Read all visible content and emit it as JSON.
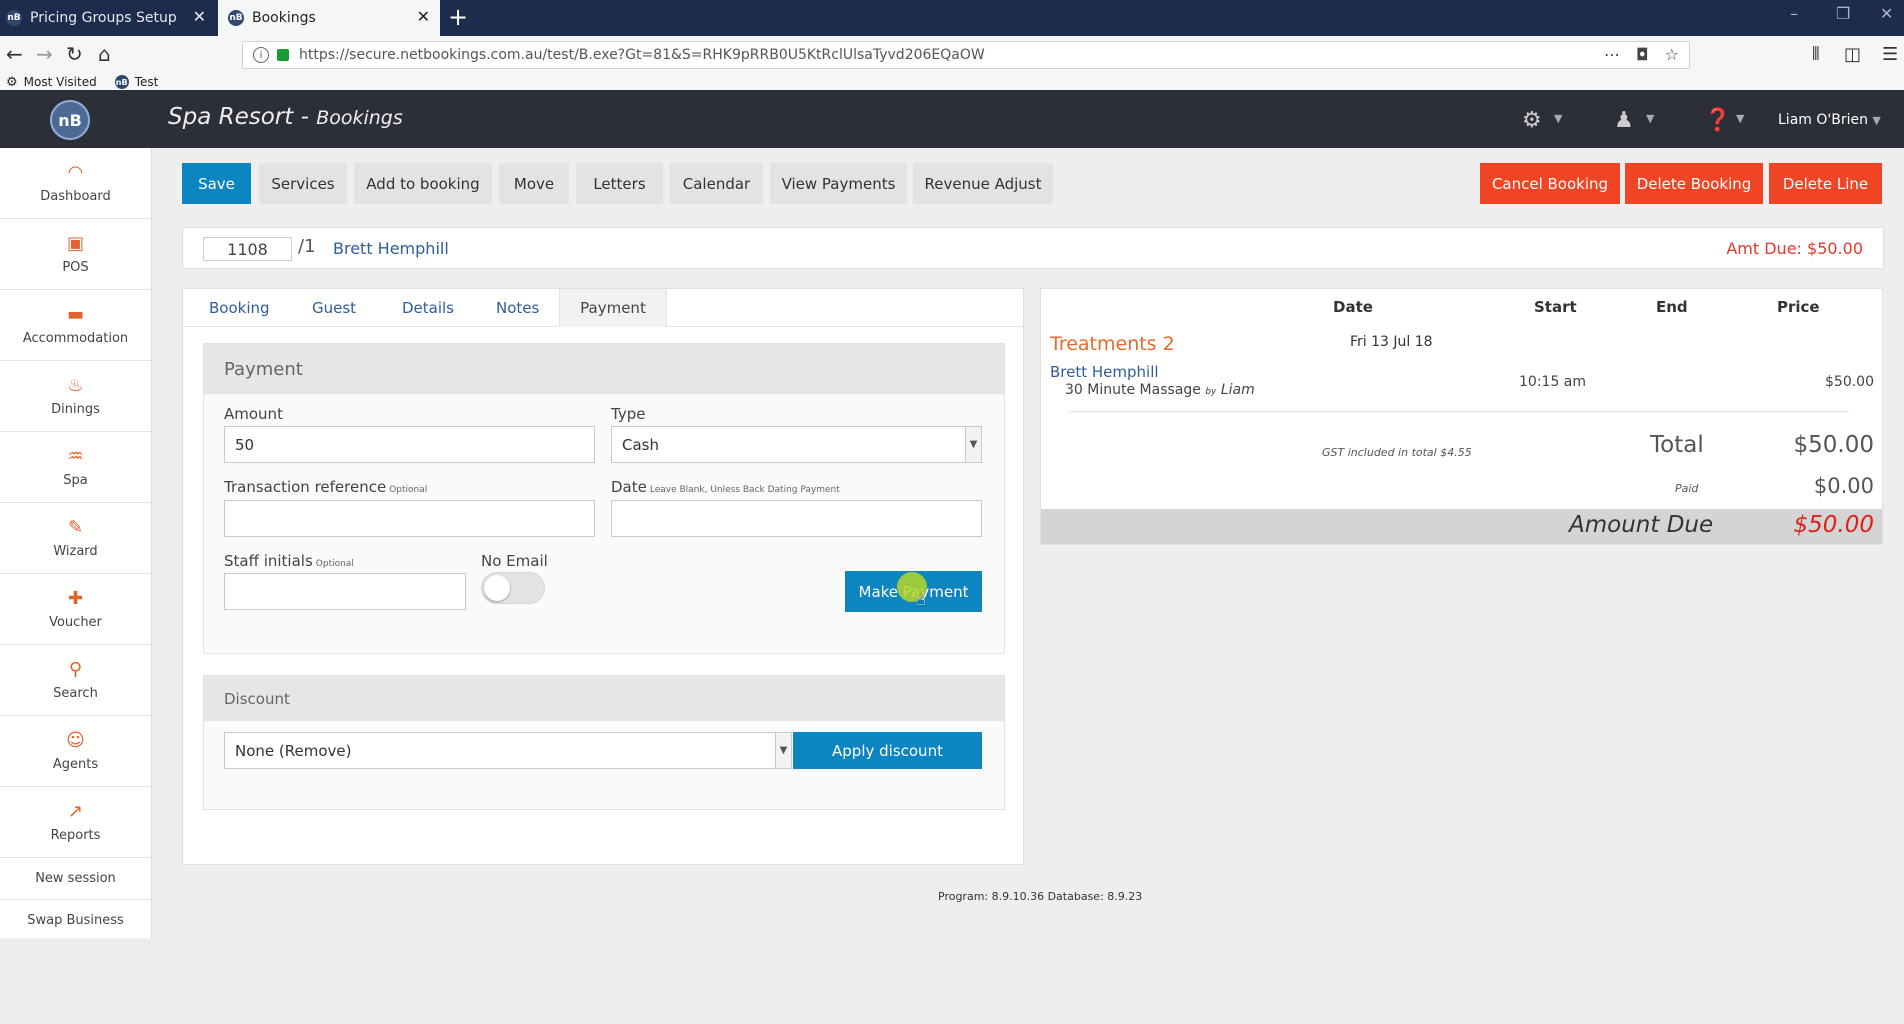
{
  "browser": {
    "tabs": [
      {
        "title": "Pricing Groups Setup",
        "favicon": "nB"
      },
      {
        "title": "Bookings",
        "favicon": "nB"
      }
    ],
    "close_glyph": "✕",
    "new_tab_glyph": "+",
    "url": "https://secure.netbookings.com.au/test/B.exe?Gt=81&S=RHK9pRRB0U5KtRclUlsaTyvd206EQaOW",
    "bookmarks": [
      {
        "label": "Most Visited",
        "icon": "gear-icon"
      },
      {
        "label": "Test",
        "icon": "nb-logo-icon"
      }
    ]
  },
  "app": {
    "logo_text": "nB",
    "title": "Spa Resort - ",
    "subtitle": "Bookings",
    "user": "Liam O'Brien"
  },
  "sidebar": {
    "items": [
      {
        "label": "Dashboard",
        "icon": "dashboard-icon",
        "glyph": "◠"
      },
      {
        "label": "POS",
        "icon": "pos-icon",
        "glyph": "▣"
      },
      {
        "label": "Accommodation",
        "icon": "bed-icon",
        "glyph": "▬"
      },
      {
        "label": "Dinings",
        "icon": "dining-icon",
        "glyph": "♨"
      },
      {
        "label": "Spa",
        "icon": "spa-icon",
        "glyph": "♒"
      },
      {
        "label": "Wizard",
        "icon": "wand-icon",
        "glyph": "✎"
      },
      {
        "label": "Voucher",
        "icon": "gift-icon",
        "glyph": "✚"
      },
      {
        "label": "Search",
        "icon": "search-icon",
        "glyph": "⚲"
      },
      {
        "label": "Agents",
        "icon": "agent-icon",
        "glyph": "☺"
      },
      {
        "label": "Reports",
        "icon": "reports-icon",
        "glyph": "↗"
      }
    ],
    "new_session": "New session",
    "swap_business": "Swap Business"
  },
  "toolbar": {
    "save": "Save",
    "services": "Services",
    "add_to_booking": "Add to booking",
    "move": "Move",
    "letters": "Letters",
    "calendar": "Calendar",
    "view_payments": "View Payments",
    "revenue_adjust": "Revenue Adjust",
    "cancel_booking": "Cancel Booking",
    "delete_booking": "Delete Booking",
    "delete_line": "Delete Line"
  },
  "booking": {
    "number": "1108",
    "suffix": "/1",
    "guest": "Brett Hemphill",
    "amt_due": "Amt Due: $50.00"
  },
  "tabs": [
    "Booking",
    "Guest",
    "Details",
    "Notes",
    "Payment"
  ],
  "payment": {
    "heading": "Payment",
    "amount_label": "Amount",
    "amount_value": "50",
    "type_label": "Type",
    "type_value": "Cash",
    "txn_label": "Transaction reference",
    "txn_hint": "Optional",
    "date_label": "Date",
    "date_hint": "Leave Blank, Unless Back Dating Payment",
    "staff_label": "Staff initials",
    "staff_hint": "Optional",
    "no_email_label": "No Email",
    "no_email_on": false,
    "make_payment": "Make Payment"
  },
  "discount": {
    "heading": "Discount",
    "selected": "None (Remove)",
    "apply": "Apply discount"
  },
  "summary": {
    "headers": {
      "date": "Date",
      "start": "Start",
      "end": "End",
      "price": "Price"
    },
    "group": "Treatments 2",
    "group_date": "Fri 13 Jul 18",
    "guest": "Brett Hemphill",
    "service": "30 Minute Massage",
    "by": "by",
    "staff": "Liam",
    "start": "10:15 am",
    "price": "$50.00",
    "gst_note": "GST included in total $4.55",
    "total_label": "Total",
    "total_value": "$50.00",
    "paid_label": "Paid",
    "paid_value": "$0.00",
    "amount_due_label": "Amount Due",
    "amount_due_value": "$50.00"
  },
  "footer": "Program: 8.9.10.36 Database: 8.9.23"
}
